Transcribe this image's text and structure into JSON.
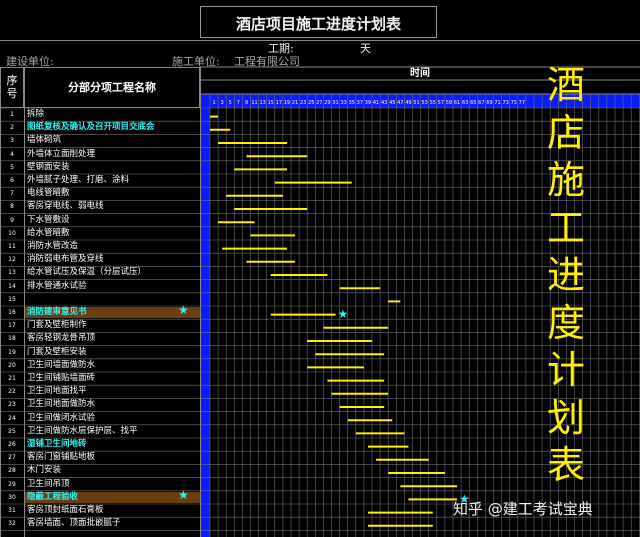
{
  "title": "酒店项目施工进度计划表",
  "duration_label": "工期:",
  "duration_value": "天",
  "build_unit_label": "建设单位:",
  "construct_unit_label": "施工单位:",
  "construct_unit_value": "工程有限公司",
  "seq_header": "序号",
  "name_header": "分部分项工程名称",
  "time_header": "时间",
  "day_ticks": [
    "1",
    "3",
    "5",
    "7",
    "9",
    "11",
    "13",
    "15",
    "17",
    "19",
    "21",
    "23",
    "25",
    "27",
    "29",
    "31",
    "33",
    "35",
    "37",
    "39",
    "41",
    "43",
    "45",
    "47",
    "49",
    "51",
    "53",
    "55",
    "57",
    "59",
    "61",
    "63",
    "65",
    "67",
    "69",
    "71",
    "73",
    "75",
    "77"
  ],
  "overlay_title": "酒店施工进度计划表",
  "watermark": "知乎 @建工考试宝典",
  "colors": {
    "bar": "#ffef00",
    "star": "#2ff3f3",
    "highlight": "#6b3e10",
    "header_blue": "#0a1cff",
    "cyan_text": "#2ff3f3"
  },
  "tasks": [
    {
      "no": "1",
      "name": "拆除",
      "start": 1,
      "end": 3
    },
    {
      "no": "2",
      "name": "图纸复核及确认及召开项目交底会",
      "start": 1,
      "end": 6,
      "style": "cyan"
    },
    {
      "no": "3",
      "name": "墙体砌筑",
      "start": 3,
      "end": 20
    },
    {
      "no": "4",
      "name": "外墙体立面削处理",
      "start": 10,
      "end": 25
    },
    {
      "no": "5",
      "name": "壁钢面安装",
      "start": 7,
      "end": 20
    },
    {
      "no": "6",
      "name": "外墙腻子处理、打磨、涂料",
      "start": 17,
      "end": 36
    },
    {
      "no": "7",
      "name": "电线管暗敷",
      "start": 5,
      "end": 19
    },
    {
      "no": "8",
      "name": "客房穿电线、弱电线",
      "start": 7,
      "end": 25
    },
    {
      "no": "9",
      "name": "下水管敷设",
      "start": 3,
      "end": 12
    },
    {
      "no": "10",
      "name": "给水管暗敷",
      "start": 11,
      "end": 22
    },
    {
      "no": "11",
      "name": "消防水管改造",
      "start": 4,
      "end": 20
    },
    {
      "no": "12",
      "name": "消防弱电布管及穿线",
      "start": 10,
      "end": 22
    },
    {
      "no": "13",
      "name": "给水管试压及保温（分层试压）",
      "start": 16,
      "end": 30
    },
    {
      "no": "14",
      "name": "排水管通水试验",
      "start": 33,
      "end": 43
    },
    {
      "no": "15",
      "name": "",
      "start": 45,
      "end": 48
    },
    {
      "no": "16",
      "name": "消防建审意见书",
      "start": 16,
      "end": 32,
      "style": "hl",
      "star": true
    },
    {
      "no": "17",
      "name": "门套及壁柜制作",
      "start": 29,
      "end": 45
    },
    {
      "no": "18",
      "name": "客房轻钢龙骨吊顶",
      "start": 25,
      "end": 41
    },
    {
      "no": "19",
      "name": "门套及壁柜安装",
      "start": 27,
      "end": 44
    },
    {
      "no": "20",
      "name": "卫生间墙面做防水",
      "start": 25,
      "end": 39
    },
    {
      "no": "21",
      "name": "卫生间铺贴墙面砖",
      "start": 30,
      "end": 44
    },
    {
      "no": "22",
      "name": "卫生间地面找平",
      "start": 31,
      "end": 45
    },
    {
      "no": "23",
      "name": "卫生间地面做防水",
      "start": 33,
      "end": 44
    },
    {
      "no": "24",
      "name": "卫生间做闭水试验",
      "start": 35,
      "end": 46
    },
    {
      "no": "25",
      "name": "卫生间做防水层保护层、找平",
      "start": 37,
      "end": 49
    },
    {
      "no": "26",
      "name": "湿铺卫生间地砖",
      "start": 40,
      "end": 50,
      "style": "cyan"
    },
    {
      "no": "27",
      "name": "客房门窗铺贴地板",
      "start": 42,
      "end": 55
    },
    {
      "no": "28",
      "name": "木门安装",
      "start": 45,
      "end": 59
    },
    {
      "no": "29",
      "name": "卫生间吊顶",
      "start": 48,
      "end": 62
    },
    {
      "no": "30",
      "name": "隐蔽工程验收",
      "start": 50,
      "end": 62,
      "style": "hl",
      "star": true
    },
    {
      "no": "31",
      "name": "客房顶封纸面石膏板",
      "start": 40,
      "end": 56
    },
    {
      "no": "32",
      "name": "客房墙面、顶面批嵌腻子",
      "start": 40,
      "end": 56
    }
  ]
}
